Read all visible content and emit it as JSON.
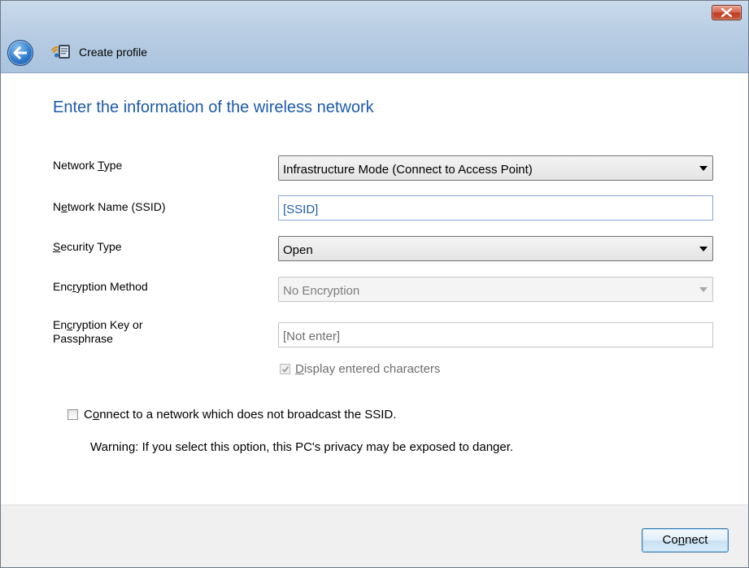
{
  "window": {
    "title": "Create profile",
    "icons": {
      "back": "back-arrow-icon",
      "profile": "wireless-profile-icon",
      "close": "close-icon"
    }
  },
  "heading": "Enter the information of the wireless network",
  "form": {
    "network_type": {
      "label_pre": "Network ",
      "label_mnemonic": "T",
      "label_post": "ype",
      "value": "Infrastructure Mode (Connect to Access Point)"
    },
    "network_name": {
      "label_pre": "N",
      "label_mnemonic": "e",
      "label_post": "twork Name (SSID)",
      "value": "[SSID]"
    },
    "security_type": {
      "label_pre": "",
      "label_mnemonic": "S",
      "label_post": "ecurity Type",
      "value": "Open"
    },
    "encryption_method": {
      "label_pre": "Enc",
      "label_mnemonic": "r",
      "label_post": "yption Method",
      "value": "No Encryption"
    },
    "encryption_key": {
      "label_pre": "En",
      "label_mnemonic": "c",
      "label_post": "ryption Key or",
      "label_line2": "Passphrase",
      "value": "[Not enter]"
    },
    "display_chars": {
      "label_mnemonic": "D",
      "label_post": "isplay entered characters",
      "checked": true
    },
    "hidden_ssid": {
      "label_pre": "C",
      "label_mnemonic": "o",
      "label_post": "nnect to a network which does not broadcast the SSID.",
      "checked": false
    },
    "warning": "Warning: If you select this option, this PC's privacy may be exposed to danger."
  },
  "footer": {
    "connect_pre": "Co",
    "connect_mnemonic": "n",
    "connect_post": "nect"
  },
  "colors": {
    "heading": "#1e5aa8",
    "field_text": "#1e5aa8"
  }
}
